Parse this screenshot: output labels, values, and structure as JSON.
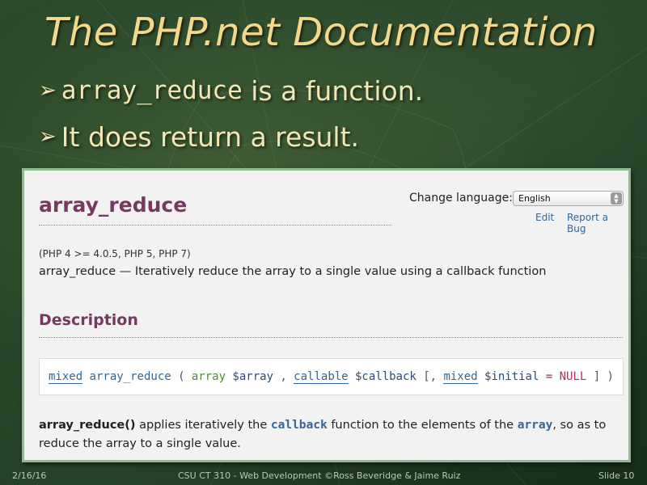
{
  "slide": {
    "title": "The PHP.net Documentation",
    "bullets": [
      {
        "mono_part": "array_reduce",
        "text": " is a function."
      },
      {
        "mono_part": "",
        "text": "It does return a result."
      }
    ]
  },
  "doc": {
    "heading": "array_reduce",
    "change_language_label": "Change language:",
    "language_selected": "English",
    "links": {
      "edit": "Edit",
      "report_bug": "Report a Bug"
    },
    "versions": "(PHP 4 >= 4.0.5, PHP 5, PHP 7)",
    "refpurpose": "array_reduce — Iteratively reduce the array to a single value using a callback function",
    "description_heading": "Description",
    "synopsis": {
      "return_type": "mixed",
      "func_name": "array_reduce",
      "open": "(",
      "p1_type": "array",
      "p1_var": "$array",
      "comma": ",",
      "p2_type": "callable",
      "p2_var": "$callback",
      "opt_open": "[,",
      "p3_type": "mixed",
      "p3_var": "$initial",
      "eq": "=",
      "default": "NULL",
      "close": "] )"
    },
    "paragraph": {
      "fn": "array_reduce()",
      "t1": " applies iteratively the ",
      "code1": "callback",
      "t2": " function to the elements of the ",
      "code2": "array",
      "t3": ", so as to reduce the array to a single value."
    }
  },
  "footer": {
    "date": "2/16/16",
    "center": "CSU CT 310 - Web Development ©Ross Beveridge & Jaime Ruiz",
    "slide_number": "Slide 10"
  },
  "colors": {
    "title": "#f3d78a",
    "php_heading": "#793862",
    "link": "#336699",
    "frame_border": "#8fbc8f"
  }
}
